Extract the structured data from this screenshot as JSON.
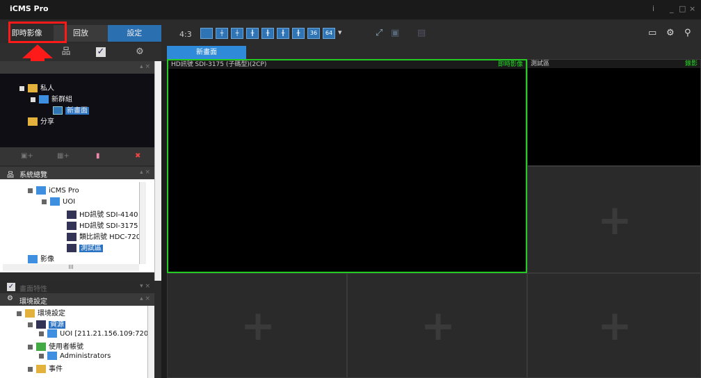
{
  "app": {
    "title": "iCMS Pro",
    "info_label": "i",
    "min_label": "_",
    "max_label": "□",
    "close_label": "×"
  },
  "left_tabs": [
    "即時影像",
    "回放",
    "設定"
  ],
  "groups_panel": {
    "tree": [
      {
        "label": "私人"
      },
      {
        "label": "新群組"
      },
      {
        "label": "新畫面",
        "selected": true
      },
      {
        "label": "分享"
      }
    ]
  },
  "system_panel": {
    "title": "系統總覽",
    "tree": [
      {
        "label": "iCMS Pro"
      },
      {
        "label": "UOI"
      },
      {
        "label": "HD訊號  SDI-4140 ("
      },
      {
        "label": "HD訊號  SDI-3175 ("
      },
      {
        "label": "類比訊號  HDC-720"
      },
      {
        "label": "測試區",
        "selected": true
      },
      {
        "label": "影像"
      }
    ],
    "scroll_label": "III"
  },
  "page_props": {
    "title": "畫面特性"
  },
  "env_panel": {
    "title": "環境設定",
    "tree": [
      {
        "label": "環境設定"
      },
      {
        "label": "資源",
        "selected": true
      },
      {
        "label": "UOI [211.21.156.109:720]"
      },
      {
        "label": "使用者帳號"
      },
      {
        "label": "Administrators"
      },
      {
        "label": "事件"
      }
    ]
  },
  "toolbar": {
    "ratio": "4:3",
    "layout_36": "36",
    "layout_64": "64",
    "dropdown": "▾"
  },
  "page_tab": "新畫面",
  "cells": {
    "main": {
      "title": "HD訊號  SDI-3175 (子碼型)(2CP)",
      "status": "即時影像"
    },
    "side": {
      "title": "測試區",
      "status": "錄影"
    }
  },
  "colors": {
    "accent": "#2a6fb0",
    "highlight": "#ff1a1a",
    "live": "#22dd22"
  }
}
